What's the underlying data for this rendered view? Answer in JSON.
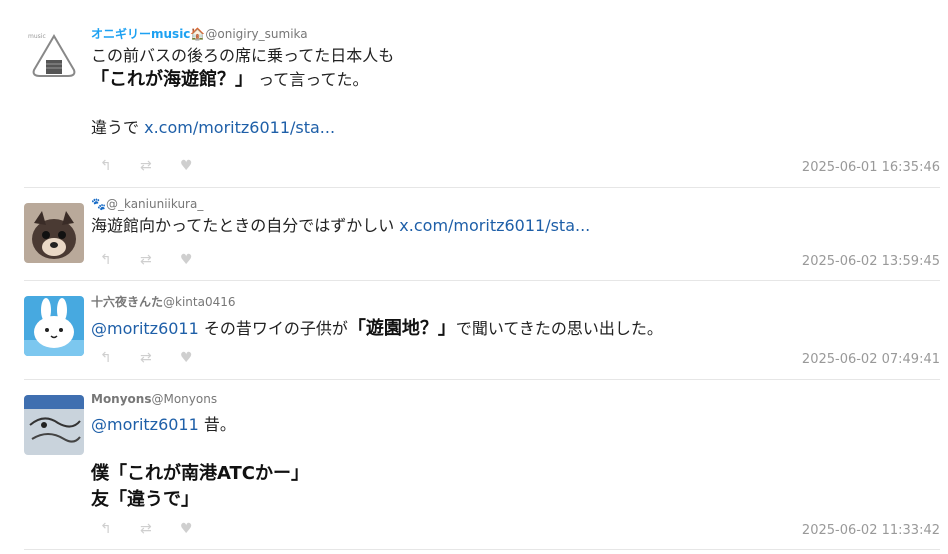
{
  "tweets": [
    {
      "display_name": "オニギリーmusic",
      "display_name_color": "#1da1f2",
      "badge": "🏠",
      "handle": "@onigiry_sumika",
      "line1": "この前バスの後ろの席に乗ってた日本人も",
      "line2_em": "「これが海遊館？」",
      "line2_rest": "って言ってた。",
      "line3_prefix": "違うで ",
      "link": "x.com/moritz6011/sta...",
      "timestamp": "2025-06-01 16:35:46"
    },
    {
      "display_name": "",
      "badge": "🐾",
      "handle": "@_kaniuniikura_",
      "text": "海遊館向かってたときの自分ではずかしい ",
      "link": "x.com/moritz6011/sta...",
      "timestamp": "2025-06-02 13:59:45"
    },
    {
      "display_name": "十六夜きんた",
      "handle": "@kinta0416",
      "mention": "@moritz6011",
      "text_before": " その昔ワイの子供が",
      "text_em": "「遊園地？」",
      "text_after": "で聞いてきたの思い出した。",
      "timestamp": "2025-06-02 07:49:41"
    },
    {
      "display_name": "Monyons",
      "handle": "@Monyons",
      "mention": "@moritz6011",
      "text_after_mention": " 昔。",
      "quote_line1": "僕「これが南港ATCかー」",
      "quote_line2": "友「違うで」",
      "timestamp": "2025-06-02 11:33:42"
    }
  ],
  "icons": {
    "reply": "reply-icon",
    "retweet": "retweet-icon",
    "like": "heart-icon",
    "reply_glyph": "↰",
    "retweet_glyph": "⇄",
    "like_glyph": "♥"
  },
  "colors": {
    "link": "#1e5fa8",
    "timestamp": "#999999",
    "divider": "#e6e6e6"
  }
}
